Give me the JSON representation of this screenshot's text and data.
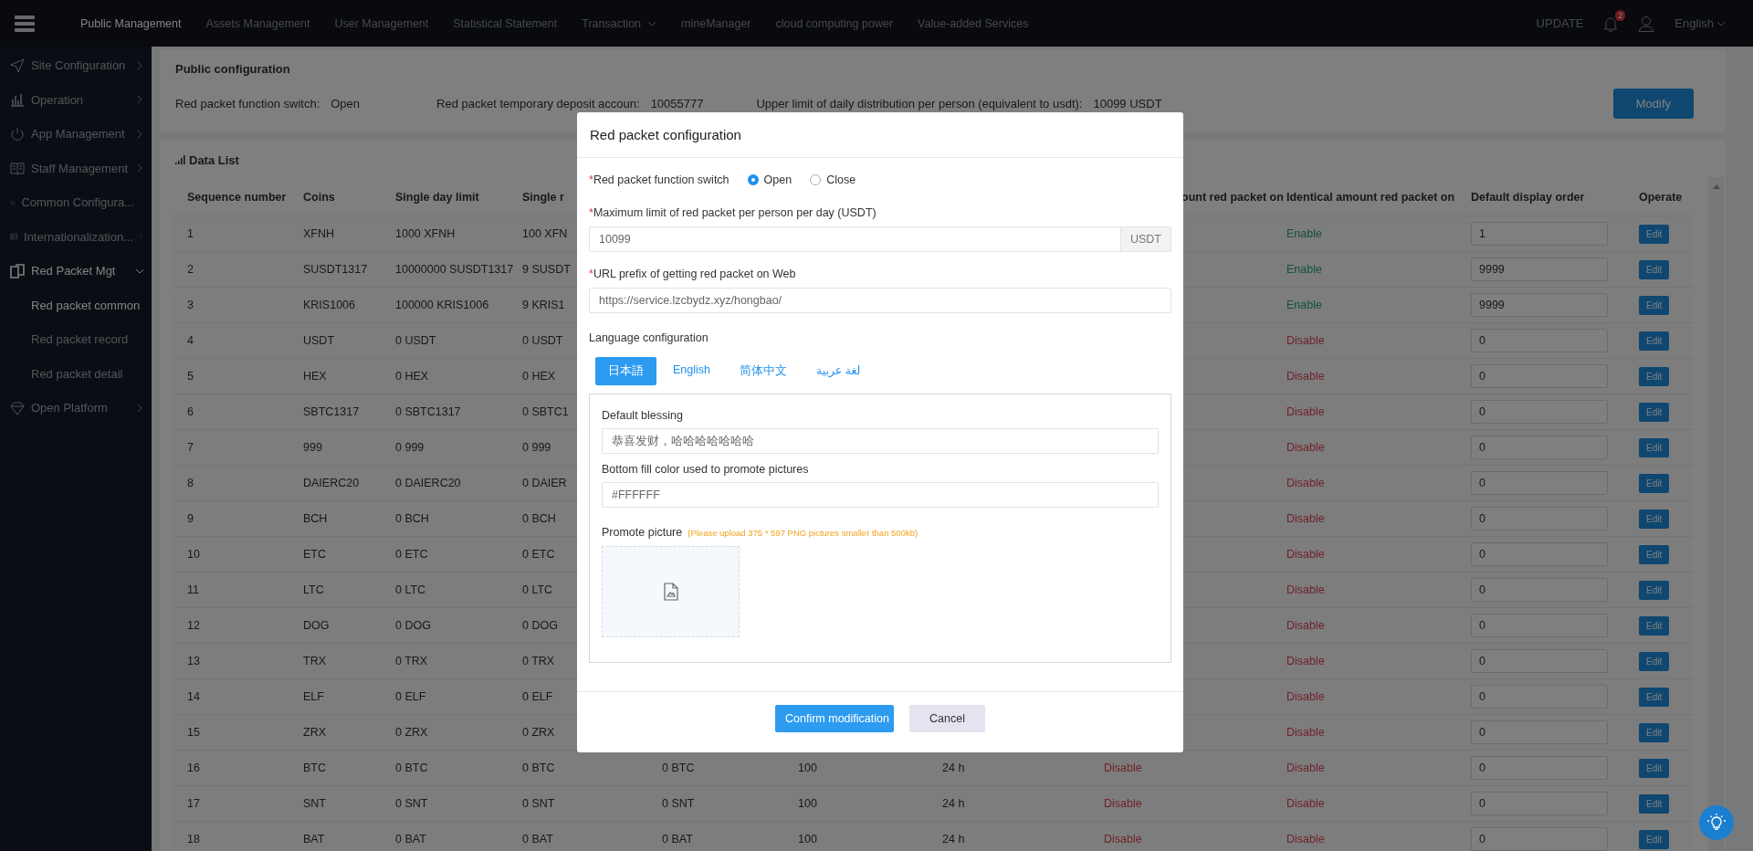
{
  "topbar": {
    "menu": [
      {
        "label": "Public Management",
        "selected": true,
        "dropdown": false
      },
      {
        "label": "Assets Management",
        "selected": false,
        "dropdown": false
      },
      {
        "label": "User Management",
        "selected": false,
        "dropdown": false
      },
      {
        "label": "Statistical Statement",
        "selected": false,
        "dropdown": false
      },
      {
        "label": "Transaction",
        "selected": false,
        "dropdown": true
      },
      {
        "label": "mineManager",
        "selected": false,
        "dropdown": false
      },
      {
        "label": "cloud computing power",
        "selected": false,
        "dropdown": false
      },
      {
        "label": "Value-added Services",
        "selected": false,
        "dropdown": false
      }
    ],
    "update": "UPDATE",
    "notification_count": "2",
    "language": "English"
  },
  "sidebar": {
    "items": [
      {
        "label": "Site Configuration",
        "expanded": false
      },
      {
        "label": "Operation",
        "expanded": false
      },
      {
        "label": "App Management",
        "expanded": false
      },
      {
        "label": "Staff Management",
        "expanded": false
      },
      {
        "label": "Common Configura...",
        "expanded": false
      },
      {
        "label": "Internationalization...",
        "expanded": false
      },
      {
        "label": "Red Packet Mgt",
        "expanded": true,
        "children": [
          {
            "label": "Red packet common",
            "selected": true
          },
          {
            "label": "Red packet record",
            "selected": false
          },
          {
            "label": "Red packet detail",
            "selected": false
          }
        ]
      },
      {
        "label": "Open Platform",
        "expanded": false
      }
    ]
  },
  "public_config": {
    "title": "Public configuration",
    "fields": [
      {
        "label": "Red packet function switch:",
        "value": "Open"
      },
      {
        "label": "Red packet temporary deposit accoun:",
        "value": "10055777"
      },
      {
        "label": "Upper limit of daily distribution per person (equivalent to usdt):",
        "value": "10099 USDT"
      }
    ],
    "modify_button": "Modify"
  },
  "data_list": {
    "title": "Data List",
    "columns": {
      "sequence_number": "Sequence number",
      "coins": "Coins",
      "single_day_limit": "Single day limit",
      "column_4": "Single r",
      "column_8": "ount red packet on",
      "identical": "Identical amount red packet on",
      "order": "Default display order",
      "operate": "Operate"
    },
    "rows": [
      {
        "sequence_number": "1",
        "coins": "XFNH",
        "single_day_limit": "1000 XFNH",
        "column_4": "100 XFN",
        "identical": {
          "text": "Enable",
          "enabled": true
        },
        "order": "1",
        "operate": "Edit"
      },
      {
        "sequence_number": "2",
        "coins": "SUSDT1317",
        "single_day_limit": "10000000 SUSDT1317",
        "column_4": "9 SUSDT",
        "identical": {
          "text": "Enable",
          "enabled": true
        },
        "order": "9999",
        "operate": "Edit"
      },
      {
        "sequence_number": "3",
        "coins": "KRIS1006",
        "single_day_limit": "100000 KRIS1006",
        "column_4": "9 KRIS1",
        "identical": {
          "text": "Enable",
          "enabled": true
        },
        "order": "9999",
        "operate": "Edit"
      },
      {
        "sequence_number": "4",
        "coins": "USDT",
        "single_day_limit": "0 USDT",
        "column_4": "0 USDT",
        "identical": {
          "text": "Disable",
          "enabled": false
        },
        "order": "0",
        "operate": "Edit"
      },
      {
        "sequence_number": "5",
        "coins": "HEX",
        "single_day_limit": "0 HEX",
        "column_4": "0 HEX",
        "identical": {
          "text": "Disable",
          "enabled": false
        },
        "order": "0",
        "operate": "Edit"
      },
      {
        "sequence_number": "6",
        "coins": "SBTC1317",
        "single_day_limit": "0 SBTC1317",
        "column_4": "0 SBTC1",
        "identical": {
          "text": "Disable",
          "enabled": false
        },
        "order": "0",
        "operate": "Edit"
      },
      {
        "sequence_number": "7",
        "coins": "999",
        "single_day_limit": "0 999",
        "column_4": "0 999",
        "identical": {
          "text": "Disable",
          "enabled": false
        },
        "order": "0",
        "operate": "Edit"
      },
      {
        "sequence_number": "8",
        "coins": "DAIERC20",
        "single_day_limit": "0 DAIERC20",
        "column_4": "0 DAIER",
        "identical": {
          "text": "Disable",
          "enabled": false
        },
        "order": "0",
        "operate": "Edit"
      },
      {
        "sequence_number": "9",
        "coins": "BCH",
        "single_day_limit": "0 BCH",
        "column_4": "0 BCH",
        "identical": {
          "text": "Disable",
          "enabled": false
        },
        "order": "0",
        "operate": "Edit"
      },
      {
        "sequence_number": "10",
        "coins": "ETC",
        "single_day_limit": "0 ETC",
        "column_4": "0 ETC",
        "identical": {
          "text": "Disable",
          "enabled": false
        },
        "order": "0",
        "operate": "Edit"
      },
      {
        "sequence_number": "11",
        "coins": "LTC",
        "single_day_limit": "0 LTC",
        "column_4": "0 LTC",
        "identical": {
          "text": "Disable",
          "enabled": false
        },
        "order": "0",
        "operate": "Edit"
      },
      {
        "sequence_number": "12",
        "coins": "DOG",
        "single_day_limit": "0 DOG",
        "column_4": "0 DOG",
        "identical": {
          "text": "Disable",
          "enabled": false
        },
        "order": "0",
        "operate": "Edit"
      },
      {
        "sequence_number": "13",
        "coins": "TRX",
        "single_day_limit": "0 TRX",
        "column_4": "0 TRX",
        "identical": {
          "text": "Disable",
          "enabled": false
        },
        "order": "0",
        "operate": "Edit"
      },
      {
        "sequence_number": "14",
        "coins": "ELF",
        "single_day_limit": "0 ELF",
        "column_4": "0 ELF",
        "identical": {
          "text": "Disable",
          "enabled": false
        },
        "order": "0",
        "operate": "Edit"
      },
      {
        "sequence_number": "15",
        "coins": "ZRX",
        "single_day_limit": "0 ZRX",
        "column_4": "0 ZRX",
        "identical": {
          "text": "Disable",
          "enabled": false
        },
        "order": "0",
        "operate": "Edit"
      },
      {
        "sequence_number": "16",
        "coins": "BTC",
        "single_day_limit": "0 BTC",
        "column_4": "0 BTC",
        "column_5": "0 BTC",
        "column_6": "100",
        "column_7": "24 h",
        "column_8": {
          "text": "Disable",
          "enabled": false
        },
        "identical": {
          "text": "Disable",
          "enabled": false
        },
        "order": "0",
        "operate": "Edit"
      },
      {
        "sequence_number": "17",
        "coins": "SNT",
        "single_day_limit": "0 SNT",
        "column_4": "0 SNT",
        "column_5": "0 SNT",
        "column_6": "100",
        "column_7": "24 h",
        "column_8": {
          "text": "Disable",
          "enabled": false
        },
        "identical": {
          "text": "Disable",
          "enabled": false
        },
        "order": "0",
        "operate": "Edit"
      },
      {
        "sequence_number": "18",
        "coins": "BAT",
        "single_day_limit": "0 BAT",
        "column_4": "0 BAT",
        "column_5": "0 BAT",
        "column_6": "100",
        "column_7": "24 h",
        "column_8": {
          "text": "Disable",
          "enabled": false
        },
        "identical": {
          "text": "Disable",
          "enabled": false
        },
        "order": "0",
        "operate": "Edit"
      }
    ]
  },
  "modal": {
    "title": "Red packet configuration",
    "switch": {
      "required_mark": "*",
      "label": "Red packet function switch",
      "options": [
        {
          "label": "Open",
          "selected": true
        },
        {
          "label": "Close",
          "selected": false
        }
      ]
    },
    "max_limit": {
      "required_mark": "*",
      "label": "Maximum limit of red packet per person per day (USDT)",
      "value": "10099",
      "suffix": "USDT"
    },
    "url_prefix": {
      "required_mark": "*",
      "label": "URL prefix of getting red packet on Web",
      "value": "https://service.lzcbydz.xyz/hongbao/"
    },
    "language_config": {
      "label": "Language configuration",
      "tabs": [
        {
          "label": "日本語",
          "selected": true
        },
        {
          "label": "English",
          "selected": false
        },
        {
          "label": "简体中文",
          "selected": false
        },
        {
          "label": "لغة عربية",
          "selected": false
        }
      ]
    },
    "default_blessing": {
      "label": "Default blessing",
      "value": "恭喜发财，哈哈哈哈哈哈哈"
    },
    "fill_color": {
      "label": "Bottom fill color used to promote pictures",
      "value": "#FFFFFF"
    },
    "promote_picture": {
      "label": "Promote picture",
      "hint": "(Please upload 375 * 597 PNG pictures smaller than 500kb)"
    },
    "buttons": {
      "confirm": "Confirm modification",
      "cancel": "Cancel"
    }
  }
}
